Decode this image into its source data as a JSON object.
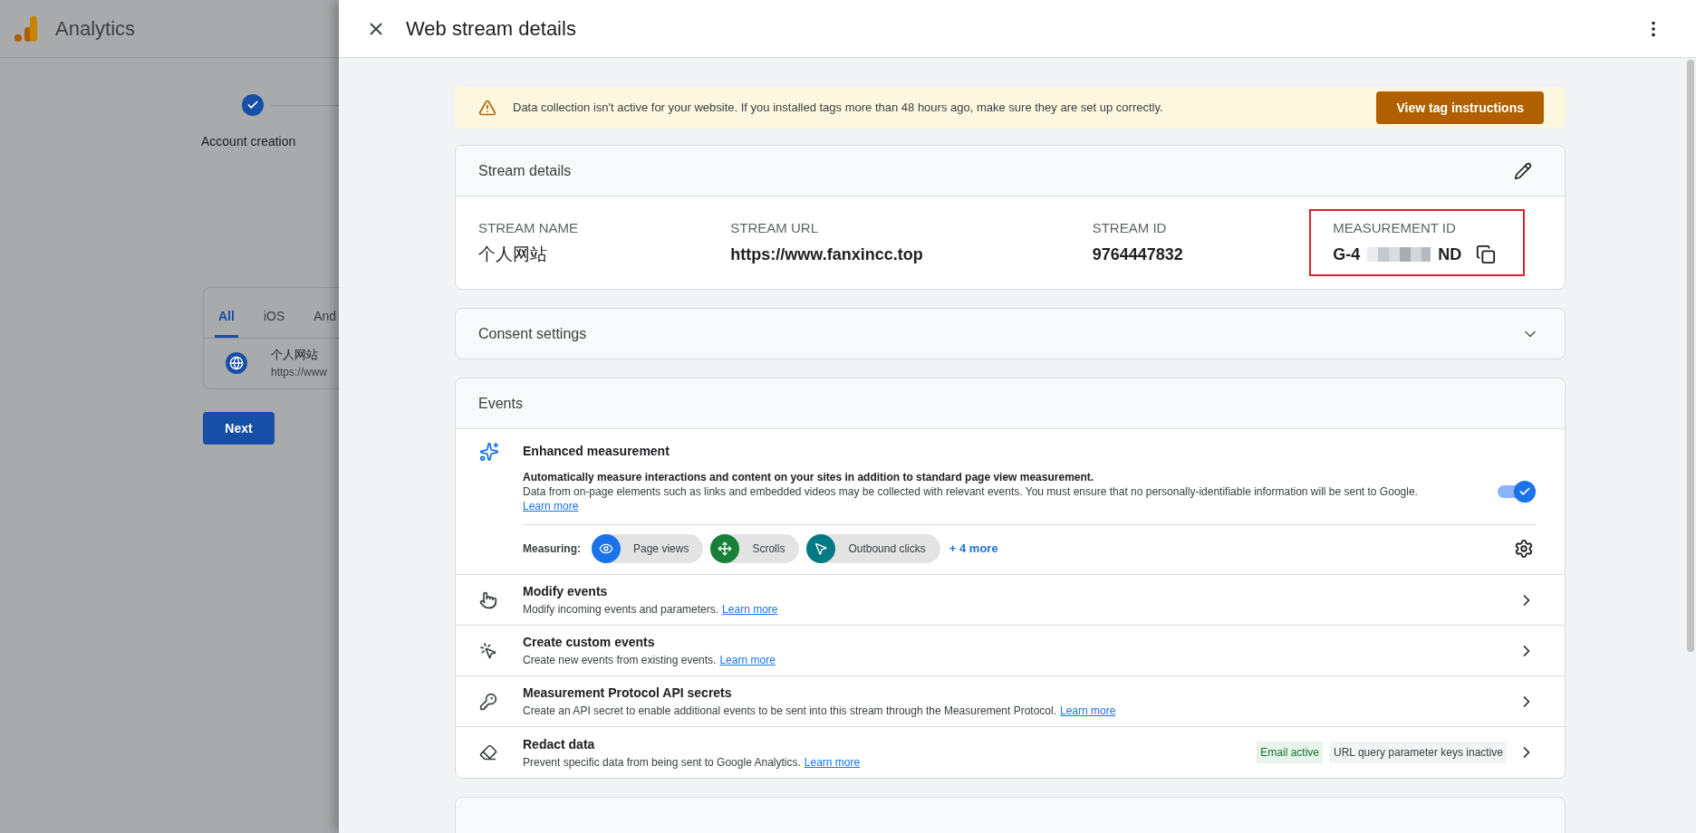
{
  "background": {
    "app_name": "Analytics",
    "stepper": [
      {
        "label": "Account creation",
        "done": true
      }
    ],
    "stream_tabs": [
      {
        "label": "All",
        "selected": true
      },
      {
        "label": "iOS",
        "selected": false
      },
      {
        "label": "And",
        "selected": false
      }
    ],
    "stream_item": {
      "name": "个人网站",
      "url": "https://www"
    },
    "next_button": "Next"
  },
  "header": {
    "title": "Web stream details"
  },
  "banner": {
    "message": "Data collection isn't active for your website. If you installed tags more than 48 hours ago, make sure they are set up correctly.",
    "button": "View tag instructions"
  },
  "stream_details": {
    "title": "Stream details",
    "fields": [
      {
        "kind": "plain",
        "label": "STREAM NAME",
        "value": "个人网站",
        "highlighted": false
      },
      {
        "kind": "bold",
        "label": "STREAM URL",
        "value": "https://www.fanxincc.top",
        "highlighted": false
      },
      {
        "kind": "bold",
        "label": "STREAM ID",
        "value": "9764447832",
        "highlighted": false
      },
      {
        "kind": "masked",
        "label": "MEASUREMENT ID",
        "value_start": "G-4",
        "value_end": "ND",
        "highlighted": true
      }
    ]
  },
  "consent": {
    "title": "Consent settings",
    "expanded": false
  },
  "events": {
    "title": "Events",
    "enhanced": {
      "title": "Enhanced measurement",
      "description": "Automatically measure interactions and content on your sites in addition to standard page view measurement.",
      "note": "Data from on-page elements such as links and embedded videos may be collected with relevant events. You must ensure that no personally-identifiable information will be sent to Google.",
      "link": "Learn more",
      "on": true,
      "measuring_label": "Measuring:",
      "chips": [
        {
          "label": "Page views",
          "color": "#1a73e8"
        },
        {
          "label": "Scrolls",
          "color": "#188038"
        },
        {
          "label": "Outbound clicks",
          "color": "#007b83"
        }
      ],
      "more": "+ 4 more"
    },
    "rows": [
      {
        "title": "Modify events",
        "description": "Modify incoming events and parameters.",
        "link": "Learn more"
      },
      {
        "title": "Create custom events",
        "description": "Create new events from existing events.",
        "link": "Learn more"
      },
      {
        "title": "Measurement Protocol API secrets",
        "description": "Create an API secret to enable additional events to be sent into this stream through the Measurement Protocol.",
        "link": "Learn more"
      },
      {
        "title": "Redact data",
        "description": "Prevent specific data from being sent to Google Analytics.",
        "link": "Learn more",
        "badges": [
          {
            "label": "Email active",
            "active": true
          },
          {
            "label": "URL query parameter keys inactive",
            "active": false
          }
        ]
      }
    ]
  }
}
